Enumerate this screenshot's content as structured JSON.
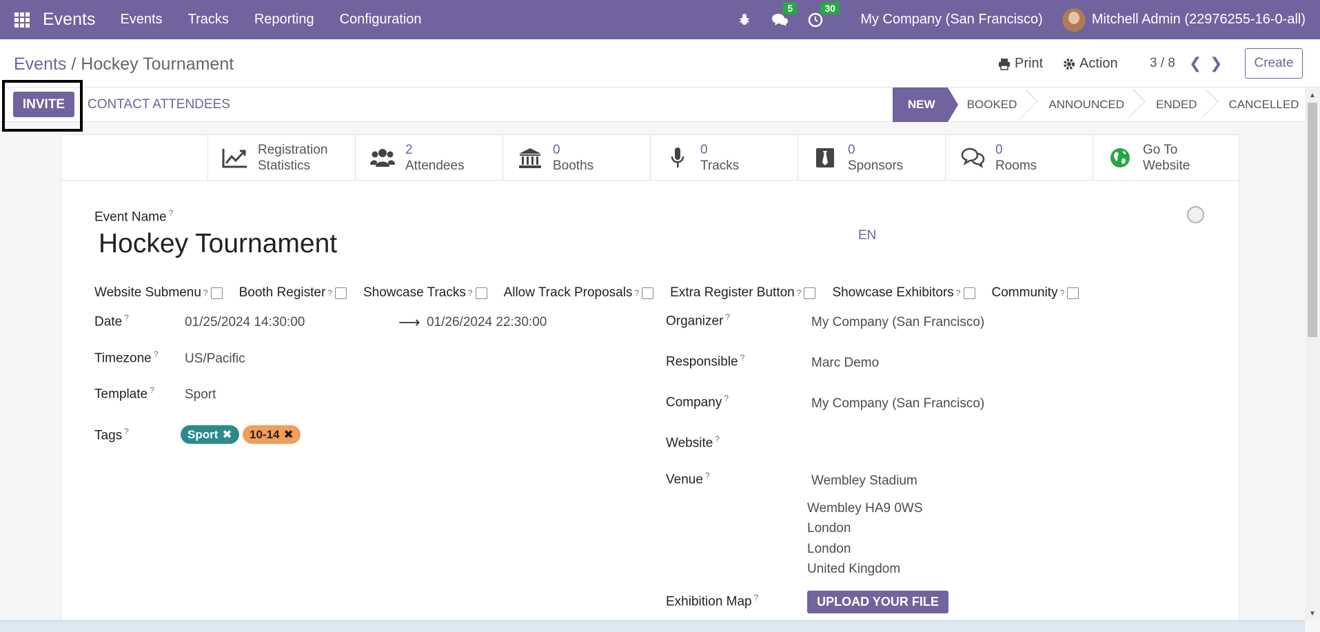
{
  "topbar": {
    "app_name": "Events",
    "menu": [
      "Events",
      "Tracks",
      "Reporting",
      "Configuration"
    ],
    "messages_count": "5",
    "activities_count": "30",
    "company": "My Company (San Francisco)",
    "user": "Mitchell Admin (22976255-16-0-all)"
  },
  "control": {
    "breadcrumb_parent": "Events",
    "breadcrumb_sep": "/",
    "breadcrumb_current": "Hockey Tournament",
    "print": "Print",
    "action": "Action",
    "pager": "3 / 8",
    "create": "Create"
  },
  "statusbar": {
    "invite": "INVITE",
    "contact": "CONTACT ATTENDEES",
    "stages": [
      "NEW",
      "BOOKED",
      "ANNOUNCED",
      "ENDED",
      "CANCELLED"
    ],
    "active_stage": "NEW"
  },
  "smart_buttons": [
    {
      "top": "Registration",
      "bottom": "Statistics",
      "icon": "chart-line-icon"
    },
    {
      "top": "2",
      "bottom": "Attendees",
      "icon": "users-icon"
    },
    {
      "top": "0",
      "bottom": "Booths",
      "icon": "bank-icon"
    },
    {
      "top": "0",
      "bottom": "Tracks",
      "icon": "microphone-icon"
    },
    {
      "top": "0",
      "bottom": "Sponsors",
      "icon": "tie-icon"
    },
    {
      "top": "0",
      "bottom": "Rooms",
      "icon": "chat-icon"
    },
    {
      "top": "Go To",
      "bottom": "Website",
      "icon": "globe-icon"
    }
  ],
  "form": {
    "event_name_label": "Event Name",
    "event_name": "Hockey Tournament",
    "lang": "EN",
    "checkboxes": [
      "Website Submenu",
      "Booth Register",
      "Showcase Tracks",
      "Allow Track Proposals",
      "Extra Register Button",
      "Showcase Exhibitors",
      "Community"
    ],
    "date_label": "Date",
    "date_begin": "01/25/2024 14:30:00",
    "date_end": "01/26/2024 22:30:00",
    "timezone_label": "Timezone",
    "timezone": "US/Pacific",
    "template_label": "Template",
    "template": "Sport",
    "tags_label": "Tags",
    "tags": [
      "Sport",
      "10-14"
    ],
    "organizer_label": "Organizer",
    "organizer": "My Company (San Francisco)",
    "responsible_label": "Responsible",
    "responsible": "Marc Demo",
    "company_label": "Company",
    "company": "My Company (San Francisco)",
    "website_label": "Website",
    "venue_label": "Venue",
    "venue_name": "Wembley Stadium",
    "venue_address": [
      "Wembley HA9 0WS",
      "London",
      "London",
      "United Kingdom"
    ],
    "exhibition_map_label": "Exhibition Map",
    "upload": "UPLOAD YOUR FILE",
    "help_mark": "?"
  },
  "colors": {
    "brand": "#71639e",
    "tag_sport": "#2d8a8a",
    "tag_age": "#f29d5b",
    "badge": "#28a745"
  }
}
